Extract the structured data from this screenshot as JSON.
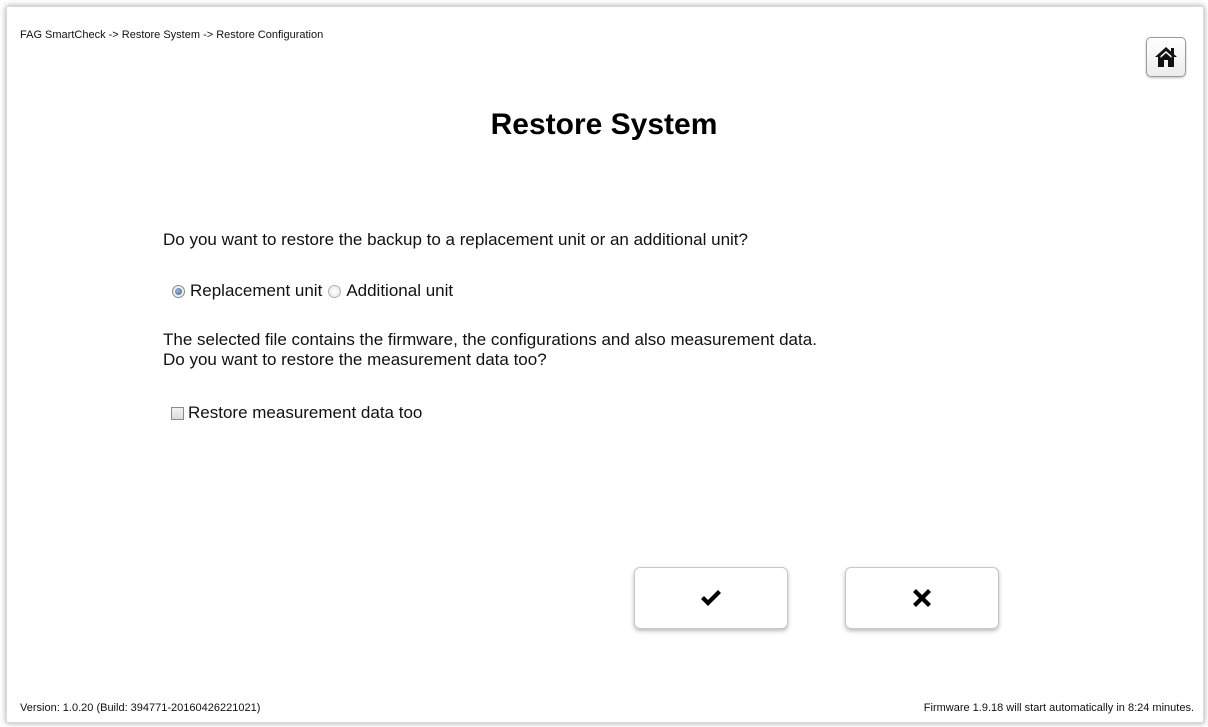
{
  "breadcrumb": "FAG SmartCheck -> Restore System -> Restore Configuration",
  "page_title": "Restore System",
  "question": "Do you want to restore the backup to a replacement unit or an additional unit?",
  "unit_options": [
    {
      "label": "Replacement unit",
      "selected": true
    },
    {
      "label": "Additional unit",
      "selected": false
    }
  ],
  "info_line1": "The selected file contains the firmware, the configurations and also measurement data.",
  "info_line2": "Do you want to restore the measurement data too?",
  "restore_measurement": {
    "label": "Restore measurement data too",
    "checked": false
  },
  "icons": {
    "home": "home-icon",
    "confirm": "check-icon",
    "cancel": "close-icon"
  },
  "footer": {
    "version": "Version: 1.0.20 (Build: 394771-20160426221021)",
    "firmware_notice": "Firmware 1.9.18 will start automatically in 8:24 minutes."
  }
}
